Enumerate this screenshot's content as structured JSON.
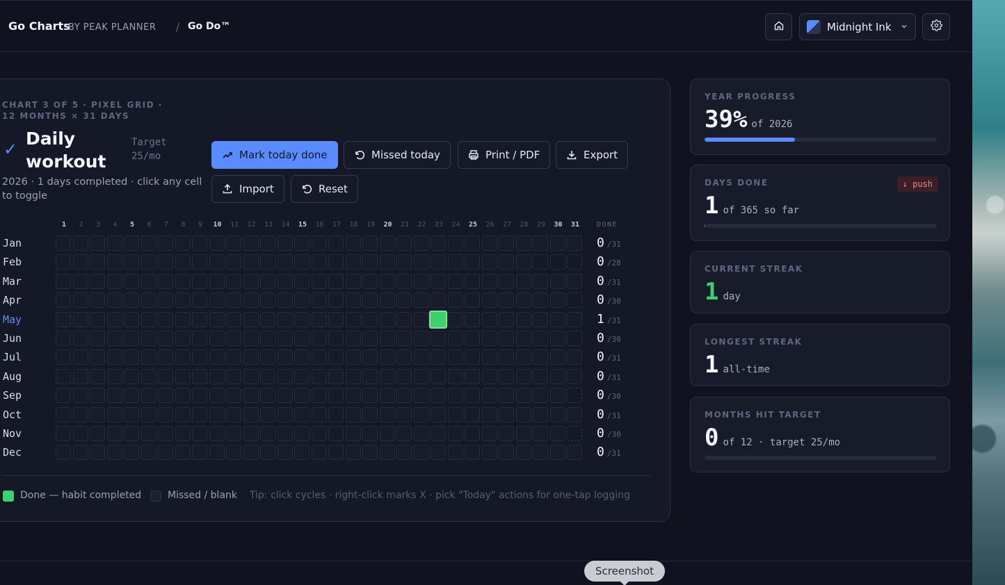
{
  "header": {
    "brand": "Go Charts",
    "brand_sub": "BY PEAK PLANNER",
    "crumb_sep": "/",
    "crumb_current": "Go Do™",
    "theme_label": "Midnight Ink",
    "icons": {
      "home": "home-icon",
      "theme_caret": "chevron-down-icon",
      "settings": "gear-icon"
    }
  },
  "chart": {
    "eyebrow": "CHART 3 OF 5 · PIXEL GRID · 12 MONTHS × 31 DAYS",
    "check": "✓",
    "title": "Daily workout",
    "target": "Target 25/mo",
    "subtitle": "2026 · 1 days completed · click any cell to toggle",
    "buttons": {
      "mark_done": "Mark today done",
      "missed": "Missed today",
      "print": "Print / PDF",
      "export": "Export",
      "import": "Import",
      "reset": "Reset"
    },
    "done_header": "DONE",
    "legend": {
      "done": "Done — habit completed",
      "missed": "Missed / blank",
      "tip": "Tip: click cycles · right-click marks X · pick \"Today\" actions for one-tap logging"
    },
    "colors": {
      "done": "#3fcf6f",
      "accent": "#5b8cff",
      "empty": "#171b2a"
    },
    "current_month": "May"
  },
  "months": [
    {
      "name": "Jan",
      "days": 31,
      "done_days": [],
      "count": "0",
      "den": "/31"
    },
    {
      "name": "Feb",
      "days": 28,
      "done_days": [],
      "count": "0",
      "den": "/28"
    },
    {
      "name": "Mar",
      "days": 31,
      "done_days": [],
      "count": "0",
      "den": "/31"
    },
    {
      "name": "Apr",
      "days": 30,
      "done_days": [],
      "count": "0",
      "den": "/30"
    },
    {
      "name": "May",
      "days": 31,
      "done_days": [
        23
      ],
      "count": "1",
      "den": "/31"
    },
    {
      "name": "Jun",
      "days": 30,
      "done_days": [],
      "count": "0",
      "den": "/30"
    },
    {
      "name": "Jul",
      "days": 31,
      "done_days": [],
      "count": "0",
      "den": "/31"
    },
    {
      "name": "Aug",
      "days": 31,
      "done_days": [],
      "count": "0",
      "den": "/31"
    },
    {
      "name": "Sep",
      "days": 30,
      "done_days": [],
      "count": "0",
      "den": "/30"
    },
    {
      "name": "Oct",
      "days": 31,
      "done_days": [],
      "count": "0",
      "den": "/31"
    },
    {
      "name": "Nov",
      "days": 30,
      "done_days": [],
      "count": "0",
      "den": "/30"
    },
    {
      "name": "Dec",
      "days": 31,
      "done_days": [],
      "count": "0",
      "den": "/31"
    }
  ],
  "stats": {
    "year_progress": {
      "label": "YEAR PROGRESS",
      "value": "39%",
      "unit": "of 2026",
      "progress": 0.39
    },
    "days_done": {
      "label": "DAYS DONE",
      "value": "1",
      "unit": "of 365 so far",
      "badge": "↓ push",
      "progress": 0.003
    },
    "current_streak": {
      "label": "CURRENT STREAK",
      "value": "1",
      "unit": "day"
    },
    "longest_streak": {
      "label": "LONGEST STREAK",
      "value": "1",
      "unit": "all-time"
    },
    "months_hit": {
      "label": "MONTHS HIT TARGET",
      "value": "0",
      "unit": "of 12 · target 25/mo",
      "progress": 0
    }
  },
  "tooltip": "Screenshot"
}
